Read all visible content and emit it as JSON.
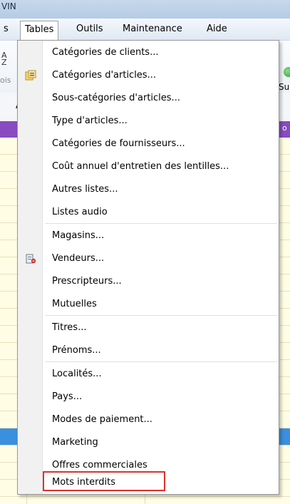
{
  "window": {
    "title_fragment": "VIN"
  },
  "menubar": {
    "items": [
      "s",
      "Tables",
      "Outils",
      "Maintenance",
      "Aide"
    ]
  },
  "toolbar": {
    "left_icon_glyphs": "A\nZ",
    "left_label": "ois",
    "right_label": "Su"
  },
  "subbar": {
    "label": "A"
  },
  "header_strip": {
    "text": "o"
  },
  "tables_menu": {
    "items": [
      {
        "label": "Catégories de clients...",
        "icon": ""
      },
      {
        "label": "Catégories d'articles...",
        "icon": "categories-icon"
      },
      {
        "label": "Sous-catégories d'articles...",
        "icon": ""
      },
      {
        "label": "Type d'articles...",
        "icon": ""
      },
      {
        "label": "Catégories de fournisseurs...",
        "icon": ""
      },
      {
        "label": "Coût annuel d'entretien des lentilles...",
        "icon": ""
      },
      {
        "label": "Autres listes...",
        "icon": ""
      },
      {
        "label": "Listes audio",
        "icon": ""
      },
      {
        "label": "Magasins...",
        "icon": ""
      },
      {
        "label": "Vendeurs...",
        "icon": "vendor-icon"
      },
      {
        "label": "Prescripteurs...",
        "icon": ""
      },
      {
        "label": "Mutuelles",
        "icon": ""
      },
      {
        "label": "Titres...",
        "icon": ""
      },
      {
        "label": "Prénoms...",
        "icon": ""
      },
      {
        "label": "Localités...",
        "icon": ""
      },
      {
        "label": "Pays...",
        "icon": ""
      },
      {
        "label": "Modes de paiement...",
        "icon": ""
      },
      {
        "label": "Marketing",
        "icon": ""
      },
      {
        "label": "Offres commerciales",
        "icon": ""
      },
      {
        "label": "Mots interdits",
        "icon": ""
      }
    ]
  },
  "colors": {
    "header_strip": "#8a4ac0",
    "selected_row": "#3b8fdf",
    "highlight_box": "#e03030"
  }
}
